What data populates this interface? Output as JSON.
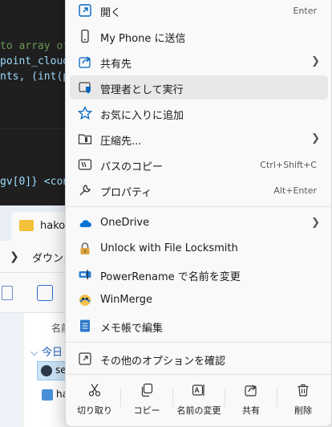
{
  "editor": {
    "lines": [
      "to array of",
      "point_cloud",
      "nts, (int(p",
      "gv[0]} <con"
    ]
  },
  "explorer": {
    "tab_label": "hakoC",
    "address_label": "ダウンロ",
    "column_header": "名前",
    "group_label": "今日",
    "files": [
      {
        "name": "se",
        "selected": true
      },
      {
        "name": "ha",
        "selected": false
      }
    ]
  },
  "menu": {
    "items": [
      {
        "label": "開く",
        "icon": "open-icon",
        "accel": "Enter"
      },
      {
        "label": "My Phone に送信",
        "icon": "phone-icon"
      },
      {
        "label": "共有先",
        "icon": "share-to-icon",
        "submenu": true
      },
      {
        "label": "管理者として実行",
        "icon": "shield-icon",
        "hover": true
      },
      {
        "label": "お気に入りに追加",
        "icon": "star-icon"
      },
      {
        "label": "圧縮先...",
        "icon": "zip-folder-icon",
        "submenu": true
      },
      {
        "label": "パスのコピー",
        "icon": "copy-path-icon",
        "accel": "Ctrl+Shift+C"
      },
      {
        "label": "プロパティ",
        "icon": "wrench-icon",
        "accel": "Alt+Enter"
      },
      {
        "label": "OneDrive",
        "icon": "onedrive-icon",
        "submenu": true
      },
      {
        "label": "Unlock with File Locksmith",
        "icon": "lock-icon"
      },
      {
        "label": "PowerRename で名前を変更",
        "icon": "powerrename-icon"
      },
      {
        "label": "WinMerge",
        "icon": "winmerge-icon"
      },
      {
        "label": "メモ帳で編集",
        "icon": "notepad-icon"
      },
      {
        "label": "その他のオプションを確認",
        "icon": "more-options-icon"
      }
    ],
    "bottom_actions": [
      {
        "label": "切り取り",
        "icon": "cut-icon"
      },
      {
        "label": "コピー",
        "icon": "copy-icon"
      },
      {
        "label": "名前の変更",
        "icon": "rename-icon"
      },
      {
        "label": "共有",
        "icon": "share-icon"
      },
      {
        "label": "削除",
        "icon": "delete-icon"
      }
    ]
  },
  "colors": {
    "menu_bg": "#f9f9fa",
    "hover_bg": "#e8e8e8",
    "accent": "#0067c0",
    "editor_bg": "#1f1f1f"
  }
}
